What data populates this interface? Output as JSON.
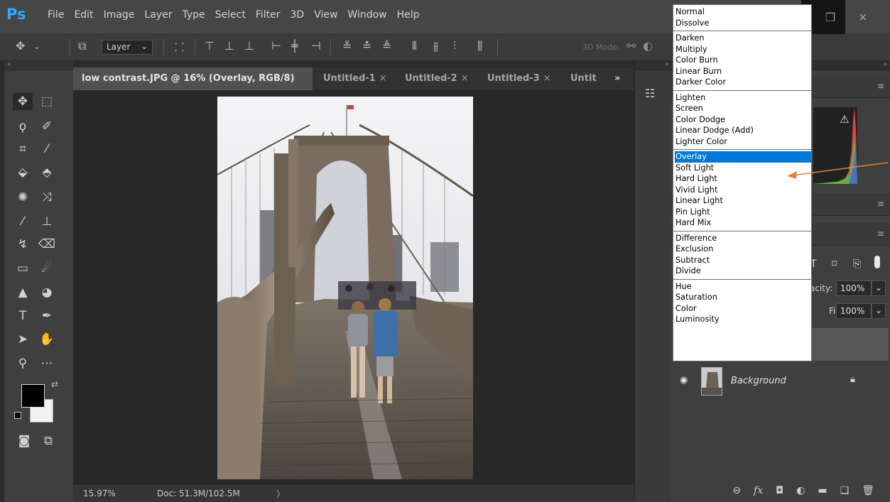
{
  "app": {
    "logo": "Ps",
    "menu": [
      "File",
      "Edit",
      "Image",
      "Layer",
      "Type",
      "Select",
      "Filter",
      "3D",
      "View",
      "Window",
      "Help"
    ]
  },
  "options_bar": {
    "layer_select": "Layer",
    "mode_3d_label": "3D Mode:"
  },
  "doc_tabs": {
    "tabs": [
      {
        "label": "low contrast.JPG @ 16% (Overlay, RGB/8) *",
        "close": "×"
      },
      {
        "label": "Untitled-1",
        "close": "×"
      },
      {
        "label": "Untitled-2",
        "close": "×"
      },
      {
        "label": "Untitled-3",
        "close": "×"
      },
      {
        "label": "Untit",
        "close": ""
      }
    ],
    "overflow": "»"
  },
  "status_bar": {
    "zoom": "15.97%",
    "doc_size": "Doc: 51.3M/102.5M",
    "arrow": "〉"
  },
  "layers_panel": {
    "opacity_label": "acity:",
    "opacity_value": "100%",
    "fill_label": "Fill:",
    "fill_value": "100%",
    "layer_name": "Background"
  },
  "blend_modes": {
    "selected": "Overlay",
    "groups": [
      [
        "Normal",
        "Dissolve"
      ],
      [
        "Darken",
        "Multiply",
        "Color Burn",
        "Linear Burn",
        "Darker Color"
      ],
      [
        "Lighten",
        "Screen",
        "Color Dodge",
        "Linear Dodge (Add)",
        "Lighter Color"
      ],
      [
        "Overlay",
        "Soft Light",
        "Hard Light",
        "Vivid Light",
        "Linear Light",
        "Pin Light",
        "Hard Mix"
      ],
      [
        "Difference",
        "Exclusion",
        "Subtract",
        "Divide"
      ],
      [
        "Hue",
        "Saturation",
        "Color",
        "Luminosity"
      ]
    ]
  },
  "colors": {
    "accent": "#31a8ff",
    "selection": "#0078d7",
    "annotation_arrow": "#e8823a",
    "foreground": "#000000",
    "background": "#f2f2f2"
  }
}
